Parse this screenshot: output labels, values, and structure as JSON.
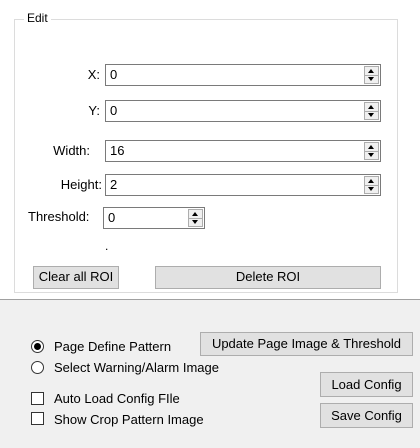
{
  "edit_group": {
    "title": "Edit",
    "fields": [
      {
        "label": "X:",
        "value": "0"
      },
      {
        "label": "Y:",
        "value": "0"
      },
      {
        "label": "Width:",
        "value": "16"
      },
      {
        "label": "Height:",
        "value": "2"
      }
    ],
    "threshold": {
      "label": "Threshold:",
      "value": "0"
    },
    "separator_dot": ".",
    "clear_all_roi_label": "Clear all ROI",
    "delete_roi_label": "Delete ROI"
  },
  "bottom": {
    "radio_options": [
      {
        "label": "Page Define Pattern",
        "checked": true
      },
      {
        "label": "Select Warning/Alarm Image",
        "checked": false
      }
    ],
    "checkboxes": [
      {
        "label": "Auto Load Config FIle",
        "checked": false
      },
      {
        "label": "Show Crop Pattern Image",
        "checked": false
      }
    ],
    "update_button_label": "Update Page Image & Threshold",
    "load_config_label": "Load Config",
    "save_config_label": "Save Config"
  }
}
